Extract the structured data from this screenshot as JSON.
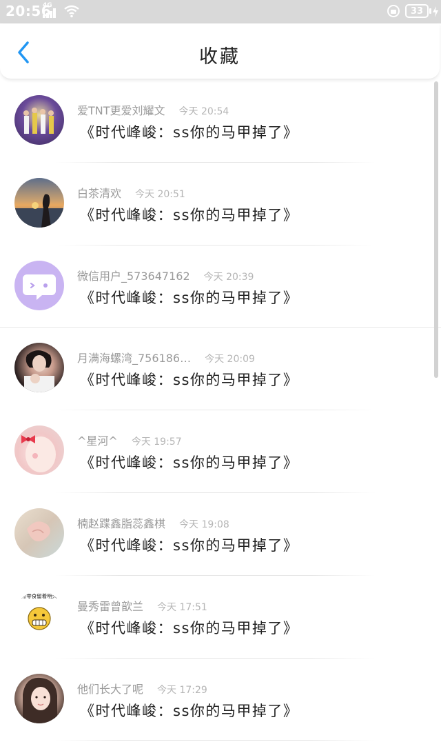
{
  "status_bar": {
    "time": "20:56",
    "network": "4G",
    "battery": "33",
    "icons": [
      "signal-icon",
      "wifi-icon",
      "lock-icon",
      "battery-icon",
      "charging-icon"
    ]
  },
  "header": {
    "title": "收藏",
    "back_icon": "chevron-left-icon",
    "accent_color": "#2196f3"
  },
  "favorites": [
    {
      "name": "爱TNT更爱刘耀文",
      "time": "今天 20:54",
      "message": "《时代峰峻：ss你的马甲掉了》"
    },
    {
      "name": "白茶清欢",
      "time": "今天 20:51",
      "message": "《时代峰峻：ss你的马甲掉了》"
    },
    {
      "name": "微信用户_573647162",
      "time": "今天 20:39",
      "message": "《时代峰峻：ss你的马甲掉了》"
    },
    {
      "name": "月满海螺湾_756186…",
      "time": "今天 20:09",
      "message": "《时代峰峻：ss你的马甲掉了》"
    },
    {
      "name": "^星河^",
      "time": "今天 19:57",
      "message": "《时代峰峻：ss你的马甲掉了》"
    },
    {
      "name": "楠赵蹀鑫脂蕊鑫棋",
      "time": "今天 19:08",
      "message": "《时代峰峻：ss你的马甲掉了》"
    },
    {
      "name": "曼秀雷曾歆兰",
      "time": "今天 17:51",
      "message": "《时代峰峻：ss你的马甲掉了》"
    },
    {
      "name": "他们长大了呢",
      "time": "今天 17:29",
      "message": "《时代峰峻：ss你的马甲掉了》"
    }
  ],
  "avatar_7_text": ".点零食留着明天."
}
